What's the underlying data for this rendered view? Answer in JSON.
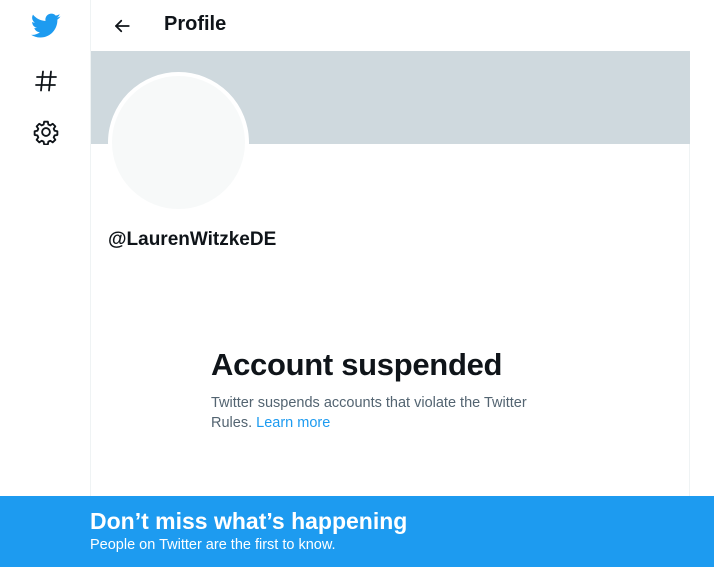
{
  "colors": {
    "accent": "#1d9bf0",
    "banner": "#cfd9de",
    "avatar_placeholder": "#f7f9f9",
    "secondary_text": "#536471"
  },
  "sidebar": {
    "items": [
      {
        "icon": "twitter-logo-icon"
      },
      {
        "icon": "hashtag-icon"
      },
      {
        "icon": "settings-gear-icon"
      }
    ]
  },
  "header": {
    "back_icon": "arrow-left-icon",
    "title": "Profile"
  },
  "profile": {
    "handle": "@LaurenWitzkeDE"
  },
  "suspension": {
    "title": "Account suspended",
    "description": "Twitter suspends accounts that violate the Twitter Rules.",
    "link_text": "Learn more"
  },
  "bottom_bar": {
    "title": "Don’t miss what’s happening",
    "subtitle": "People on Twitter are the first to know."
  }
}
